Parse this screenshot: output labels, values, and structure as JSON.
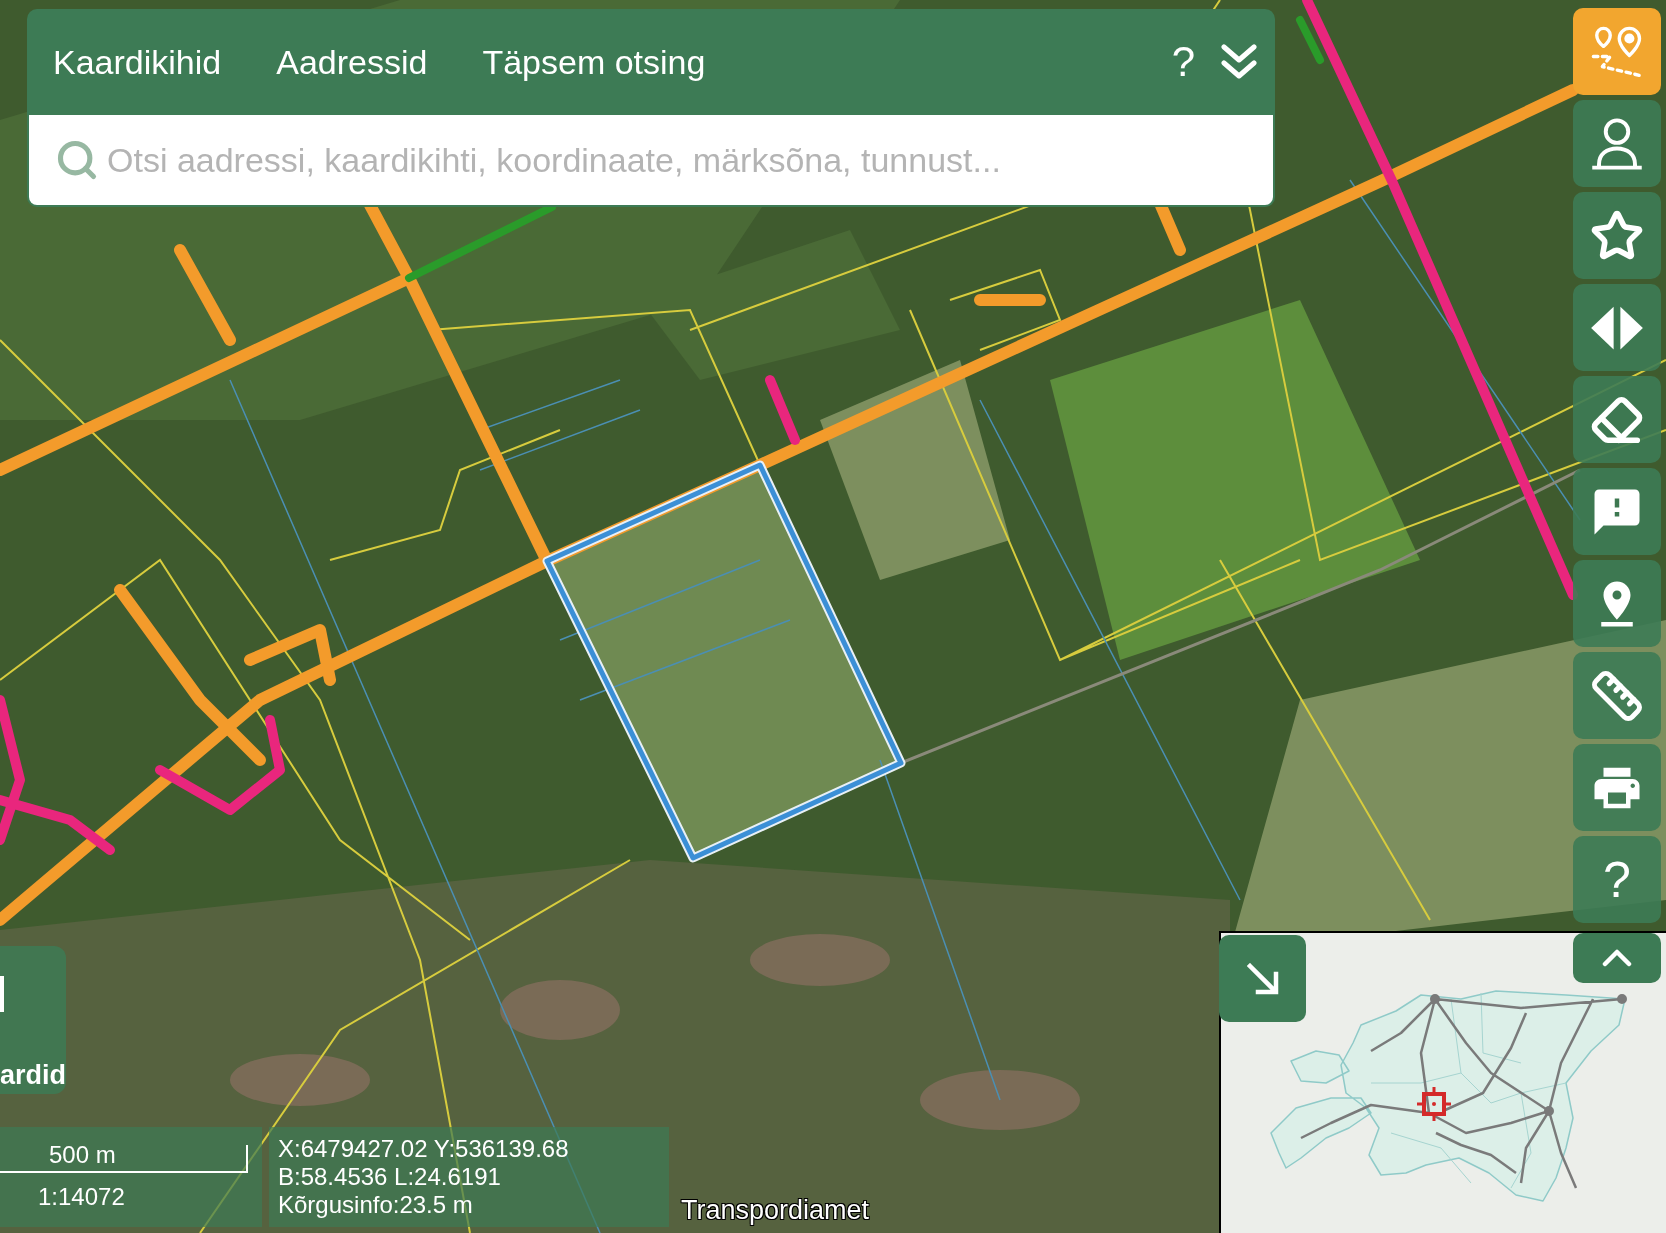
{
  "search_panel": {
    "tabs": [
      {
        "label": "Kaardikihid"
      },
      {
        "label": "Aadressid"
      },
      {
        "label": "Täpsem otsing"
      }
    ],
    "help_label": "?",
    "search": {
      "placeholder": "Otsi aadressi, kaardikihti, koordinaate, märksõna, tunnust..."
    }
  },
  "toolbar": {
    "buttons": [
      {
        "kind": "route",
        "selected": true
      },
      {
        "kind": "user",
        "selected": false
      },
      {
        "kind": "star",
        "selected": false
      },
      {
        "kind": "compare",
        "selected": false
      },
      {
        "kind": "eraser",
        "selected": false
      },
      {
        "kind": "feedback",
        "selected": false
      },
      {
        "kind": "pin",
        "selected": false
      },
      {
        "kind": "ruler",
        "selected": false
      },
      {
        "kind": "print",
        "selected": false
      },
      {
        "kind": "help",
        "label": "?",
        "selected": false
      }
    ]
  },
  "side_panel": {
    "label": "ardid"
  },
  "scale": {
    "distance": "500 m",
    "ratio": "1:14072"
  },
  "coordinates": [
    "X:6479427.02 Y:536139.68",
    "B:58.4536 L:24.6191",
    "Kõrgusinfo:23.5 m"
  ],
  "attribution": "Transpordiamet"
}
